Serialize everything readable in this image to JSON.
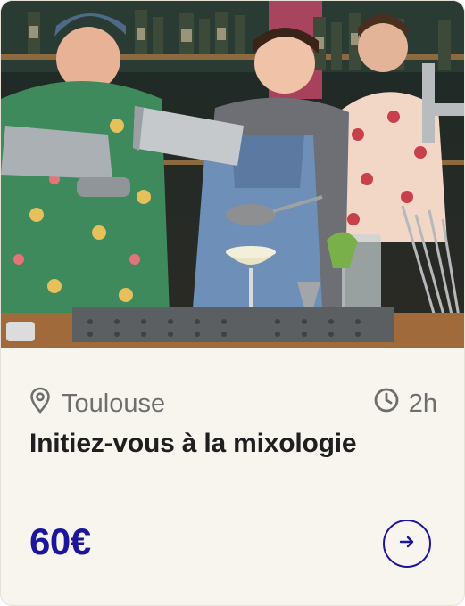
{
  "card": {
    "location": "Toulouse",
    "duration": "2h",
    "title": "Initiez-vous à la mixologie",
    "price": "60€"
  },
  "icons": {
    "location": "map-pin-icon",
    "duration": "clock-icon",
    "action": "arrow-right-icon"
  },
  "colors": {
    "accent": "#1b169c",
    "card_background": "#f8f5ef",
    "muted_text": "#6e6e6e",
    "title_text": "#1f1f1f"
  }
}
